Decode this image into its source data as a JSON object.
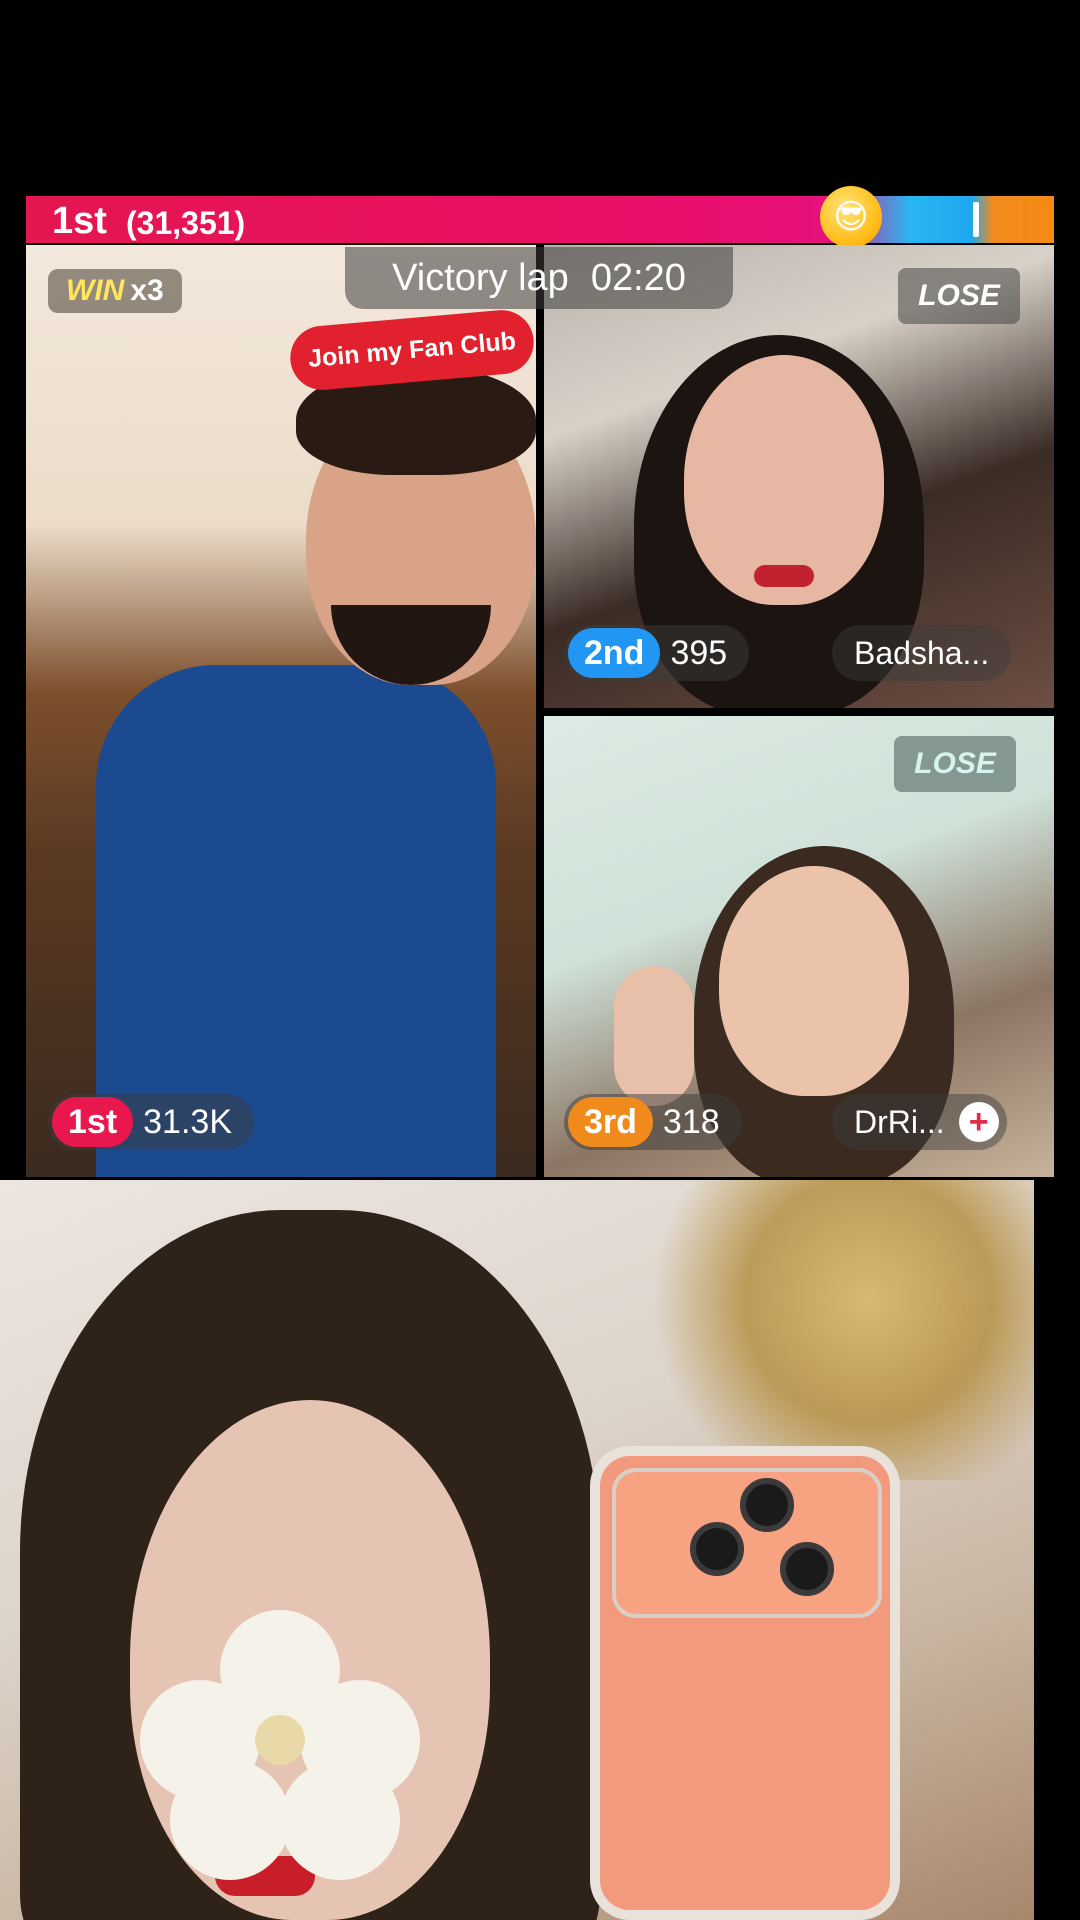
{
  "score_bar": {
    "rank": "1st",
    "score": "(31,351)"
  },
  "timer": {
    "label": "Victory lap",
    "time": "02:20"
  },
  "main_tile": {
    "win_label": "WIN",
    "win_multiplier": "x3",
    "fan_club_label": "Join my Fan Club",
    "rank": "1st",
    "points": "31.3K"
  },
  "top_right_tile": {
    "result": "LOSE",
    "rank": "2nd",
    "points": "395",
    "name": "Badsha..."
  },
  "bottom_right_tile": {
    "result": "LOSE",
    "rank": "3rd",
    "points": "318",
    "name": "DrRi...",
    "add_icon": "+"
  },
  "emoji": "😎",
  "colors": {
    "accent_pink": "#e8184f",
    "accent_blue": "#2196f3",
    "accent_orange": "#f08a1b",
    "win_yellow": "#ffe65c",
    "fan_club_red": "#e1222e"
  }
}
